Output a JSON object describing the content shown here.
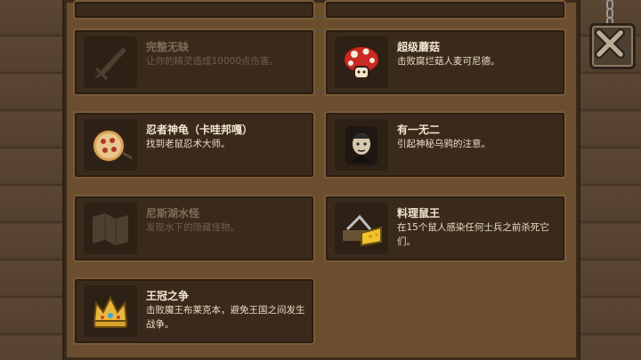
{
  "achievements": [
    {
      "title": "完整无缺",
      "desc": "让你的精灵造成10000点伤害。",
      "icon": "sword-icon",
      "locked": true
    },
    {
      "title": "超级蘑菇",
      "desc": "击败腐烂菇人麦可尼德。",
      "icon": "mushroom-icon",
      "locked": false
    },
    {
      "title": "忍者神龟（卡哇邦嘎）",
      "desc": "找到老鼠忍术大师。",
      "icon": "pizza-icon",
      "locked": false
    },
    {
      "title": "有一无二",
      "desc": "引起神秘乌鸦的注意。",
      "icon": "poe-portrait-icon",
      "locked": false
    },
    {
      "title": "尼斯湖水怪",
      "desc": "发现水下的隐藏怪物。",
      "icon": "map-icon",
      "locked": true
    },
    {
      "title": "料理鼠王",
      "desc": "在15个鼠人感染任何士兵之前杀死它们。",
      "icon": "cheese-trap-icon",
      "locked": false
    },
    {
      "title": "王冠之争",
      "desc": "击败魔王布莱克本，避免王国之间发生战争。",
      "icon": "crown-icon",
      "locked": false
    }
  ],
  "close_button": {
    "icon": "close-icon"
  }
}
